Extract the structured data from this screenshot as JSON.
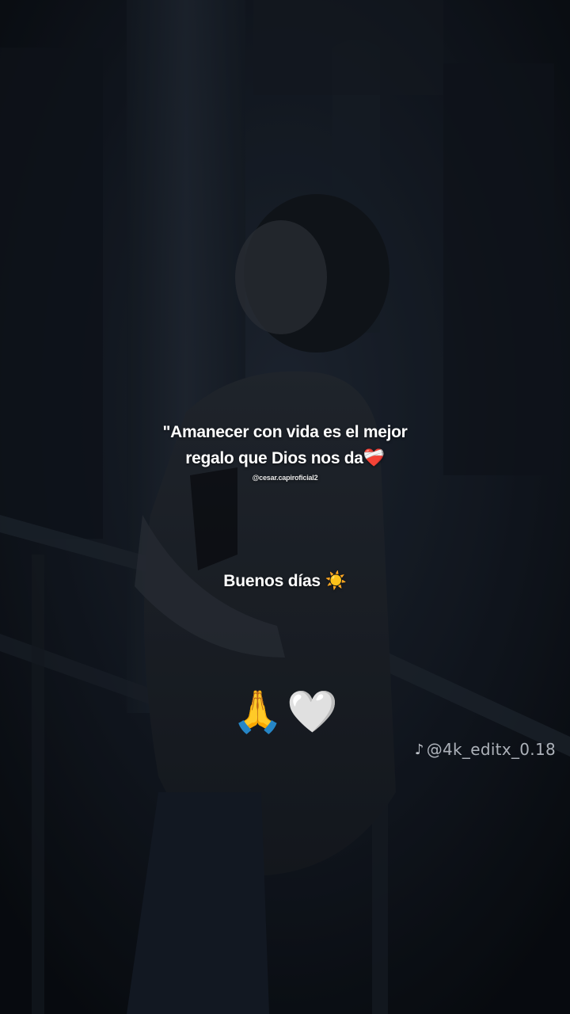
{
  "quote": {
    "line1": "\"Amanecer con vida es el mejor",
    "line2": "regalo que Dios nos da",
    "line2_emoji": "❤️‍🩹"
  },
  "handle": "@cesar.capiroficial2",
  "greeting": {
    "text": "Buenos días ",
    "emoji": "☀️"
  },
  "emojis": [
    "🙏",
    "🤍"
  ],
  "watermark": {
    "icon": "tiktok-icon",
    "text": "@4k_editx_0.18"
  },
  "colors": {
    "background": "#0f141c",
    "text": "#ffffff",
    "watermark": "#c9ced6"
  }
}
